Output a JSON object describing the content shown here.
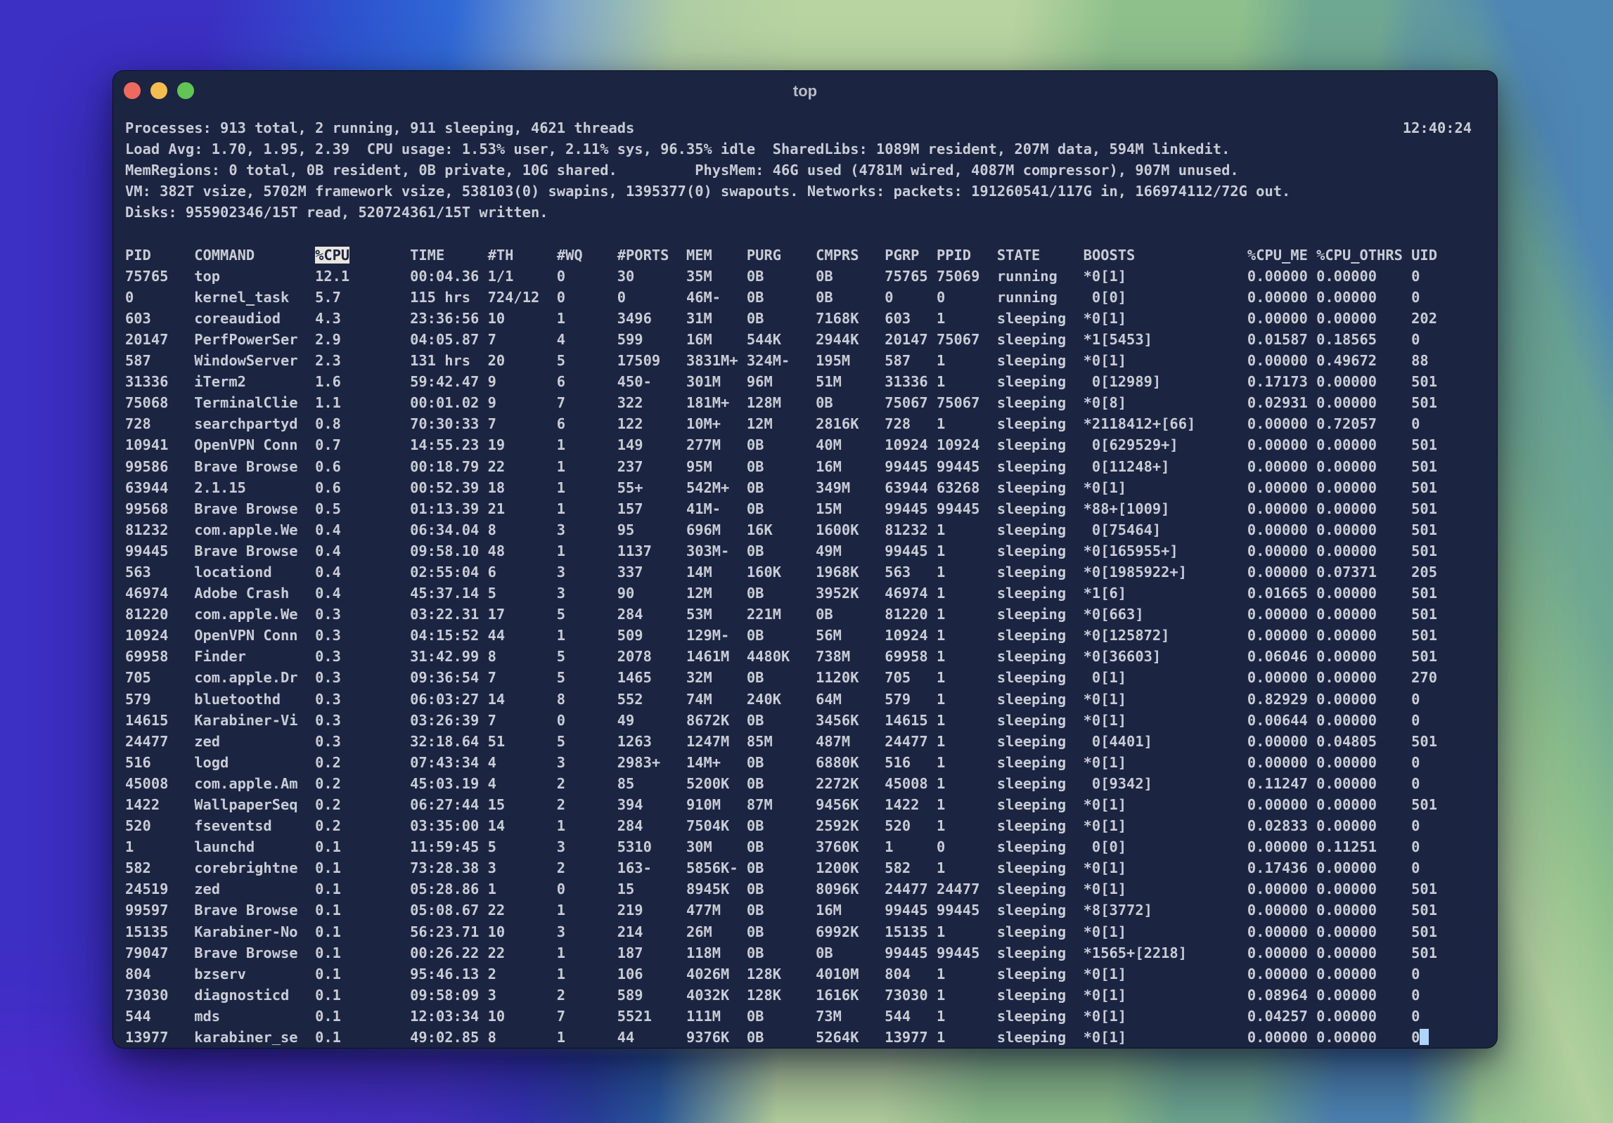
{
  "window": {
    "title": "top",
    "clock": "12:40:24",
    "traffic_lights": [
      "close",
      "minimize",
      "zoom"
    ]
  },
  "colors": {
    "window_bg": "#1b2441",
    "term_text": "#c9ccd5",
    "title_text": "#b7bbc4",
    "hl_bg": "#e9e6df",
    "hl_text": "#1b2441",
    "cursor": "#aed4fb",
    "tl_red": "#ee6a5f",
    "tl_yellow": "#f5bd4f",
    "tl_green": "#62c455",
    "wp_indigo": "#3c2fc3",
    "wp_blue": "#3069d6",
    "wp_lightgreen": "#b8d4a0",
    "wp_green": "#8ec08c",
    "wp_teal": "#6fa892",
    "wp_steel": "#4e86b4",
    "wp_violet": "#452dc7"
  },
  "summary_lines": [
    "Processes: 913 total, 2 running, 911 sleeping, 4621 threads",
    "Load Avg: 1.70, 1.95, 2.39  CPU usage: 1.53% user, 2.11% sys, 96.35% idle  SharedLibs: 1089M resident, 207M data, 594M linkedit.",
    "MemRegions: 0 total, 0B resident, 0B private, 10G shared.         PhysMem: 46G used (4781M wired, 4087M compressor), 907M unused.",
    "VM: 382T vsize, 5702M framework vsize, 538103(0) swapins, 1395377(0) swapouts. Networks: packets: 191260541/117G in, 166974112/72G out.",
    "Disks: 955902346/15T read, 520724361/15T written."
  ],
  "table": {
    "highlighted_column": "%CPU",
    "columns": [
      {
        "key": "pid",
        "label": "PID",
        "col": 0
      },
      {
        "key": "command",
        "label": "COMMAND",
        "col": 8
      },
      {
        "key": "cpu",
        "label": "%CPU",
        "col": 22
      },
      {
        "key": "time",
        "label": "TIME",
        "col": 33
      },
      {
        "key": "th",
        "label": "#TH",
        "col": 42
      },
      {
        "key": "wq",
        "label": "#WQ",
        "col": 50
      },
      {
        "key": "ports",
        "label": "#PORTS",
        "col": 57
      },
      {
        "key": "mem",
        "label": "MEM",
        "col": 65
      },
      {
        "key": "purg",
        "label": "PURG",
        "col": 72
      },
      {
        "key": "cmprs",
        "label": "CMPRS",
        "col": 80
      },
      {
        "key": "pgrp",
        "label": "PGRP",
        "col": 88
      },
      {
        "key": "ppid",
        "label": "PPID",
        "col": 94
      },
      {
        "key": "state",
        "label": "STATE",
        "col": 101
      },
      {
        "key": "boosts",
        "label": "BOOSTS",
        "col": 111
      },
      {
        "key": "cpu_me",
        "label": "%CPU_ME",
        "col": 130
      },
      {
        "key": "cpu_othrs",
        "label": "%CPU_OTHRS",
        "col": 138
      },
      {
        "key": "uid",
        "label": "UID",
        "col": 149
      }
    ],
    "rows": [
      [
        "75765",
        "top",
        "12.1",
        "00:04.36",
        "1/1",
        "0",
        "30",
        "35M",
        "0B",
        "0B",
        "75765",
        "75069",
        "running",
        "*0[1]",
        "0.00000",
        "0.00000",
        "0"
      ],
      [
        "0",
        "kernel_task",
        "5.7",
        "115 hrs",
        "724/12",
        "0",
        "0",
        "46M-",
        "0B",
        "0B",
        "0",
        "0",
        "running",
        " 0[0]",
        "0.00000",
        "0.00000",
        "0"
      ],
      [
        "603",
        "coreaudiod",
        "4.3",
        "23:36:56",
        "10",
        "1",
        "3496",
        "31M",
        "0B",
        "7168K",
        "603",
        "1",
        "sleeping",
        "*0[1]",
        "0.00000",
        "0.00000",
        "202"
      ],
      [
        "20147",
        "PerfPowerSer",
        "2.9",
        "04:05.87",
        "7",
        "4",
        "599",
        "16M",
        "544K",
        "2944K",
        "20147",
        "75067",
        "sleeping",
        "*1[5453]",
        "0.01587",
        "0.18565",
        "0"
      ],
      [
        "587",
        "WindowServer",
        "2.3",
        "131 hrs",
        "20",
        "5",
        "17509",
        "3831M+",
        "324M-",
        "195M",
        "587",
        "1",
        "sleeping",
        "*0[1]",
        "0.00000",
        "0.49672",
        "88"
      ],
      [
        "31336",
        "iTerm2",
        "1.6",
        "59:42.47",
        "9",
        "6",
        "450-",
        "301M",
        "96M",
        "51M",
        "31336",
        "1",
        "sleeping",
        " 0[12989]",
        "0.17173",
        "0.00000",
        "501"
      ],
      [
        "75068",
        "TerminalClie",
        "1.1",
        "00:01.02",
        "9",
        "7",
        "322",
        "181M+",
        "128M",
        "0B",
        "75067",
        "75067",
        "sleeping",
        "*0[8]",
        "0.02931",
        "0.00000",
        "501"
      ],
      [
        "728",
        "searchpartyd",
        "0.8",
        "70:30:33",
        "7",
        "6",
        "122",
        "10M+",
        "12M",
        "2816K",
        "728",
        "1",
        "sleeping",
        "*2118412+[66]",
        "0.00000",
        "0.72057",
        "0"
      ],
      [
        "10941",
        "OpenVPN Conn",
        "0.7",
        "14:55.23",
        "19",
        "1",
        "149",
        "277M",
        "0B",
        "40M",
        "10924",
        "10924",
        "sleeping",
        " 0[629529+]",
        "0.00000",
        "0.00000",
        "501"
      ],
      [
        "99586",
        "Brave Browse",
        "0.6",
        "00:18.79",
        "22",
        "1",
        "237",
        "95M",
        "0B",
        "16M",
        "99445",
        "99445",
        "sleeping",
        " 0[11248+]",
        "0.00000",
        "0.00000",
        "501"
      ],
      [
        "63944",
        "2.1.15",
        "0.6",
        "00:52.39",
        "18",
        "1",
        "55+",
        "542M+",
        "0B",
        "349M",
        "63944",
        "63268",
        "sleeping",
        "*0[1]",
        "0.00000",
        "0.00000",
        "501"
      ],
      [
        "99568",
        "Brave Browse",
        "0.5",
        "01:13.39",
        "21",
        "1",
        "157",
        "41M-",
        "0B",
        "15M",
        "99445",
        "99445",
        "sleeping",
        "*88+[1009]",
        "0.00000",
        "0.00000",
        "501"
      ],
      [
        "81232",
        "com.apple.We",
        "0.4",
        "06:34.04",
        "8",
        "3",
        "95",
        "696M",
        "16K",
        "1600K",
        "81232",
        "1",
        "sleeping",
        " 0[75464]",
        "0.00000",
        "0.00000",
        "501"
      ],
      [
        "99445",
        "Brave Browse",
        "0.4",
        "09:58.10",
        "48",
        "1",
        "1137",
        "303M-",
        "0B",
        "49M",
        "99445",
        "1",
        "sleeping",
        "*0[165955+]",
        "0.00000",
        "0.00000",
        "501"
      ],
      [
        "563",
        "locationd",
        "0.4",
        "02:55:04",
        "6",
        "3",
        "337",
        "14M",
        "160K",
        "1968K",
        "563",
        "1",
        "sleeping",
        "*0[1985922+]",
        "0.00000",
        "0.07371",
        "205"
      ],
      [
        "46974",
        "Adobe Crash",
        "0.4",
        "45:37.14",
        "5",
        "3",
        "90",
        "12M",
        "0B",
        "3952K",
        "46974",
        "1",
        "sleeping",
        "*1[6]",
        "0.01665",
        "0.00000",
        "501"
      ],
      [
        "81220",
        "com.apple.We",
        "0.3",
        "03:22.31",
        "17",
        "5",
        "284",
        "53M",
        "221M",
        "0B",
        "81220",
        "1",
        "sleeping",
        "*0[663]",
        "0.00000",
        "0.00000",
        "501"
      ],
      [
        "10924",
        "OpenVPN Conn",
        "0.3",
        "04:15:52",
        "44",
        "1",
        "509",
        "129M-",
        "0B",
        "56M",
        "10924",
        "1",
        "sleeping",
        "*0[125872]",
        "0.00000",
        "0.00000",
        "501"
      ],
      [
        "69958",
        "Finder",
        "0.3",
        "31:42.99",
        "8",
        "5",
        "2078",
        "1461M",
        "4480K",
        "738M",
        "69958",
        "1",
        "sleeping",
        "*0[36603]",
        "0.06046",
        "0.00000",
        "501"
      ],
      [
        "705",
        "com.apple.Dr",
        "0.3",
        "09:36:54",
        "7",
        "5",
        "1465",
        "32M",
        "0B",
        "1120K",
        "705",
        "1",
        "sleeping",
        " 0[1]",
        "0.00000",
        "0.00000",
        "270"
      ],
      [
        "579",
        "bluetoothd",
        "0.3",
        "06:03:27",
        "14",
        "8",
        "552",
        "74M",
        "240K",
        "64M",
        "579",
        "1",
        "sleeping",
        "*0[1]",
        "0.82929",
        "0.00000",
        "0"
      ],
      [
        "14615",
        "Karabiner-Vi",
        "0.3",
        "03:26:39",
        "7",
        "0",
        "49",
        "8672K",
        "0B",
        "3456K",
        "14615",
        "1",
        "sleeping",
        "*0[1]",
        "0.00644",
        "0.00000",
        "0"
      ],
      [
        "24477",
        "zed",
        "0.3",
        "32:18.64",
        "51",
        "5",
        "1263",
        "1247M",
        "85M",
        "487M",
        "24477",
        "1",
        "sleeping",
        " 0[4401]",
        "0.00000",
        "0.04805",
        "501"
      ],
      [
        "516",
        "logd",
        "0.2",
        "07:43:34",
        "4",
        "3",
        "2983+",
        "14M+",
        "0B",
        "6880K",
        "516",
        "1",
        "sleeping",
        "*0[1]",
        "0.00000",
        "0.00000",
        "0"
      ],
      [
        "45008",
        "com.apple.Am",
        "0.2",
        "45:03.19",
        "4",
        "2",
        "85",
        "5200K",
        "0B",
        "2272K",
        "45008",
        "1",
        "sleeping",
        " 0[9342]",
        "0.11247",
        "0.00000",
        "0"
      ],
      [
        "1422",
        "WallpaperSeq",
        "0.2",
        "06:27:44",
        "15",
        "2",
        "394",
        "910M",
        "87M",
        "9456K",
        "1422",
        "1",
        "sleeping",
        "*0[1]",
        "0.00000",
        "0.00000",
        "501"
      ],
      [
        "520",
        "fseventsd",
        "0.2",
        "03:35:00",
        "14",
        "1",
        "284",
        "7504K",
        "0B",
        "2592K",
        "520",
        "1",
        "sleeping",
        "*0[1]",
        "0.02833",
        "0.00000",
        "0"
      ],
      [
        "1",
        "launchd",
        "0.1",
        "11:59:45",
        "5",
        "3",
        "5310",
        "30M",
        "0B",
        "3760K",
        "1",
        "0",
        "sleeping",
        " 0[0]",
        "0.00000",
        "0.11251",
        "0"
      ],
      [
        "582",
        "corebrightne",
        "0.1",
        "73:28.38",
        "3",
        "2",
        "163-",
        "5856K-",
        "0B",
        "1200K",
        "582",
        "1",
        "sleeping",
        "*0[1]",
        "0.17436",
        "0.00000",
        "0"
      ],
      [
        "24519",
        "zed",
        "0.1",
        "05:28.86",
        "1",
        "0",
        "15",
        "8945K",
        "0B",
        "8096K",
        "24477",
        "24477",
        "sleeping",
        "*0[1]",
        "0.00000",
        "0.00000",
        "501"
      ],
      [
        "99597",
        "Brave Browse",
        "0.1",
        "05:08.67",
        "22",
        "1",
        "219",
        "477M",
        "0B",
        "16M",
        "99445",
        "99445",
        "sleeping",
        "*8[3772]",
        "0.00000",
        "0.00000",
        "501"
      ],
      [
        "15135",
        "Karabiner-No",
        "0.1",
        "56:23.71",
        "10",
        "3",
        "214",
        "26M",
        "0B",
        "6992K",
        "15135",
        "1",
        "sleeping",
        "*0[1]",
        "0.00000",
        "0.00000",
        "501"
      ],
      [
        "79047",
        "Brave Browse",
        "0.1",
        "00:26.22",
        "22",
        "1",
        "187",
        "118M",
        "0B",
        "0B",
        "99445",
        "99445",
        "sleeping",
        "*1565+[2218]",
        "0.00000",
        "0.00000",
        "501"
      ],
      [
        "804",
        "bzserv",
        "0.1",
        "95:46.13",
        "2",
        "1",
        "106",
        "4026M",
        "128K",
        "4010M",
        "804",
        "1",
        "sleeping",
        "*0[1]",
        "0.00000",
        "0.00000",
        "0"
      ],
      [
        "73030",
        "diagnosticd",
        "0.1",
        "09:58:09",
        "3",
        "2",
        "589",
        "4032K",
        "128K",
        "1616K",
        "73030",
        "1",
        "sleeping",
        "*0[1]",
        "0.08964",
        "0.00000",
        "0"
      ],
      [
        "544",
        "mds",
        "0.1",
        "12:03:34",
        "10",
        "7",
        "5521",
        "111M",
        "0B",
        "73M",
        "544",
        "1",
        "sleeping",
        "*0[1]",
        "0.04257",
        "0.00000",
        "0"
      ],
      [
        "13977",
        "karabiner_se",
        "0.1",
        "49:02.85",
        "8",
        "1",
        "44",
        "9376K",
        "0B",
        "5264K",
        "13977",
        "1",
        "sleeping",
        "*0[1]",
        "0.00000",
        "0.00000",
        "0"
      ]
    ]
  }
}
